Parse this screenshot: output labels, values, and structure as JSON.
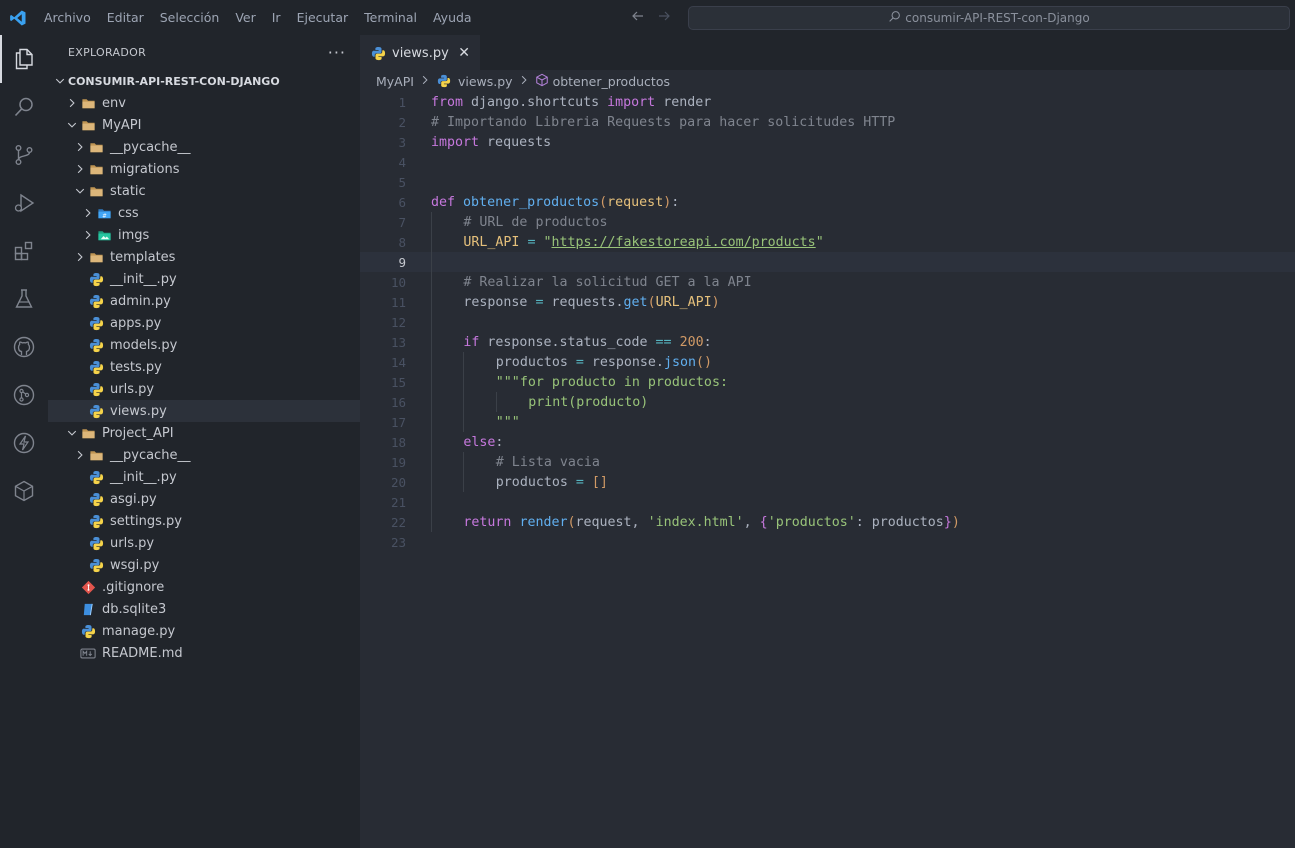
{
  "app": {
    "menu": [
      "Archivo",
      "Editar",
      "Selección",
      "Ver",
      "Ir",
      "Ejecutar",
      "Terminal",
      "Ayuda"
    ],
    "search_label": "consumir-API-REST-con-Django"
  },
  "activity": [
    "explorer-icon",
    "search-icon",
    "source-control-icon",
    "run-debug-icon",
    "extensions-icon",
    "testing-icon",
    "github-icon",
    "git-graph-icon",
    "thunder-icon",
    "docker-icon"
  ],
  "sidebar": {
    "title": "EXPLORADOR",
    "more": "···",
    "root": "CONSUMIR-API-REST-CON-DJANGO",
    "tree": [
      {
        "label": "env",
        "depth": 1,
        "kind": "folder",
        "open": false
      },
      {
        "label": "MyAPI",
        "depth": 1,
        "kind": "folder",
        "open": true
      },
      {
        "label": "__pycache__",
        "depth": 2,
        "kind": "folder",
        "open": false
      },
      {
        "label": "migrations",
        "depth": 2,
        "kind": "folder",
        "open": false
      },
      {
        "label": "static",
        "depth": 2,
        "kind": "folder",
        "open": true
      },
      {
        "label": "css",
        "depth": 3,
        "kind": "folder-css",
        "open": false
      },
      {
        "label": "imgs",
        "depth": 3,
        "kind": "folder-img",
        "open": false
      },
      {
        "label": "templates",
        "depth": 2,
        "kind": "folder",
        "open": false
      },
      {
        "label": "__init__.py",
        "depth": 2,
        "kind": "python"
      },
      {
        "label": "admin.py",
        "depth": 2,
        "kind": "python"
      },
      {
        "label": "apps.py",
        "depth": 2,
        "kind": "python"
      },
      {
        "label": "models.py",
        "depth": 2,
        "kind": "python"
      },
      {
        "label": "tests.py",
        "depth": 2,
        "kind": "python"
      },
      {
        "label": "urls.py",
        "depth": 2,
        "kind": "python"
      },
      {
        "label": "views.py",
        "depth": 2,
        "kind": "python",
        "selected": true
      },
      {
        "label": "Project_API",
        "depth": 1,
        "kind": "folder",
        "open": true
      },
      {
        "label": "__pycache__",
        "depth": 2,
        "kind": "folder",
        "open": false
      },
      {
        "label": "__init__.py",
        "depth": 2,
        "kind": "python"
      },
      {
        "label": "asgi.py",
        "depth": 2,
        "kind": "python"
      },
      {
        "label": "settings.py",
        "depth": 2,
        "kind": "python"
      },
      {
        "label": "urls.py",
        "depth": 2,
        "kind": "python"
      },
      {
        "label": "wsgi.py",
        "depth": 2,
        "kind": "python"
      },
      {
        "label": ".gitignore",
        "depth": 1,
        "kind": "git"
      },
      {
        "label": "db.sqlite3",
        "depth": 1,
        "kind": "db"
      },
      {
        "label": "manage.py",
        "depth": 1,
        "kind": "python"
      },
      {
        "label": "README.md",
        "depth": 1,
        "kind": "md"
      }
    ]
  },
  "editor": {
    "tab": {
      "label": "views.py",
      "close": "✕"
    },
    "breadcrumb": [
      "MyAPI",
      "views.py",
      "obtener_productos"
    ],
    "current_line": 9,
    "lines": [
      {
        "n": "1",
        "indent": 0,
        "tokens": [
          [
            "kw",
            "from"
          ],
          [
            "pn",
            " django.shortcuts "
          ],
          [
            "kw",
            "import"
          ],
          [
            "pn",
            " render"
          ]
        ]
      },
      {
        "n": "2",
        "indent": 0,
        "tokens": [
          [
            "cm",
            "# Importando Libreria Requests para hacer solicitudes HTTP"
          ]
        ]
      },
      {
        "n": "3",
        "indent": 0,
        "tokens": [
          [
            "kw",
            "import"
          ],
          [
            "pn",
            " requests"
          ]
        ]
      },
      {
        "n": "4",
        "indent": 0,
        "tokens": []
      },
      {
        "n": "5",
        "indent": 0,
        "tokens": []
      },
      {
        "n": "6",
        "indent": 0,
        "tokens": [
          [
            "kw",
            "def"
          ],
          [
            "pn",
            " "
          ],
          [
            "fn",
            "obtener_productos"
          ],
          [
            "par",
            "("
          ],
          [
            "var",
            "request"
          ],
          [
            "par",
            ")"
          ],
          [
            "pn",
            ":"
          ]
        ]
      },
      {
        "n": "7",
        "indent": 1,
        "tokens": [
          [
            "cm",
            "# URL de productos"
          ]
        ]
      },
      {
        "n": "8",
        "indent": 1,
        "tokens": [
          [
            "var",
            "URL_API"
          ],
          [
            "pn",
            " "
          ],
          [
            "op",
            "="
          ],
          [
            "pn",
            " "
          ],
          [
            "str",
            "\""
          ],
          [
            "url",
            "https://fakestoreapi.com/products"
          ],
          [
            "str",
            "\""
          ]
        ]
      },
      {
        "n": "9",
        "indent": 1,
        "tokens": []
      },
      {
        "n": "10",
        "indent": 1,
        "tokens": [
          [
            "cm",
            "# Realizar la solicitud GET a la API"
          ]
        ]
      },
      {
        "n": "11",
        "indent": 1,
        "tokens": [
          [
            "pn",
            "response "
          ],
          [
            "op",
            "="
          ],
          [
            "pn",
            " requests."
          ],
          [
            "fn",
            "get"
          ],
          [
            "par",
            "("
          ],
          [
            "var",
            "URL_API"
          ],
          [
            "par",
            ")"
          ]
        ]
      },
      {
        "n": "12",
        "indent": 1,
        "tokens": []
      },
      {
        "n": "13",
        "indent": 1,
        "tokens": [
          [
            "kw",
            "if"
          ],
          [
            "pn",
            " response.status_code "
          ],
          [
            "op",
            "=="
          ],
          [
            "pn",
            " "
          ],
          [
            "num",
            "200"
          ],
          [
            "pn",
            ":"
          ]
        ]
      },
      {
        "n": "14",
        "indent": 2,
        "tokens": [
          [
            "pn",
            "productos "
          ],
          [
            "op",
            "="
          ],
          [
            "pn",
            " response."
          ],
          [
            "fn",
            "json"
          ],
          [
            "par",
            "()"
          ]
        ]
      },
      {
        "n": "15",
        "indent": 2,
        "tokens": [
          [
            "str",
            "\"\"\"for producto in productos:"
          ]
        ]
      },
      {
        "n": "16",
        "indent": 3,
        "tokens": [
          [
            "str",
            "print(producto)"
          ]
        ]
      },
      {
        "n": "17",
        "indent": 2,
        "tokens": [
          [
            "str",
            "\"\"\""
          ]
        ]
      },
      {
        "n": "18",
        "indent": 1,
        "tokens": [
          [
            "kw",
            "else"
          ],
          [
            "pn",
            ":"
          ]
        ]
      },
      {
        "n": "19",
        "indent": 2,
        "tokens": [
          [
            "cm",
            "# Lista vacia"
          ]
        ]
      },
      {
        "n": "20",
        "indent": 2,
        "tokens": [
          [
            "pn",
            "productos "
          ],
          [
            "op",
            "="
          ],
          [
            "pn",
            " "
          ],
          [
            "par",
            "[]"
          ]
        ]
      },
      {
        "n": "21",
        "indent": 1,
        "tokens": []
      },
      {
        "n": "22",
        "indent": 1,
        "tokens": [
          [
            "kw",
            "return"
          ],
          [
            "pn",
            " "
          ],
          [
            "fn",
            "render"
          ],
          [
            "par",
            "("
          ],
          [
            "pn",
            "request, "
          ],
          [
            "str",
            "'index.html'"
          ],
          [
            "pn",
            ", "
          ],
          [
            "br",
            "{"
          ],
          [
            "str",
            "'productos'"
          ],
          [
            "pn",
            ": productos"
          ],
          [
            "br",
            "}"
          ],
          [
            "par",
            ")"
          ]
        ]
      },
      {
        "n": "23",
        "indent": 0,
        "tokens": []
      }
    ]
  },
  "colors": {
    "background": "#282c34",
    "sidebar": "#21252b",
    "keyword": "#c678dd",
    "function": "#61afef",
    "string": "#98c379",
    "comment": "#7f848e",
    "number": "#d19a66",
    "variable": "#e5c07b"
  }
}
